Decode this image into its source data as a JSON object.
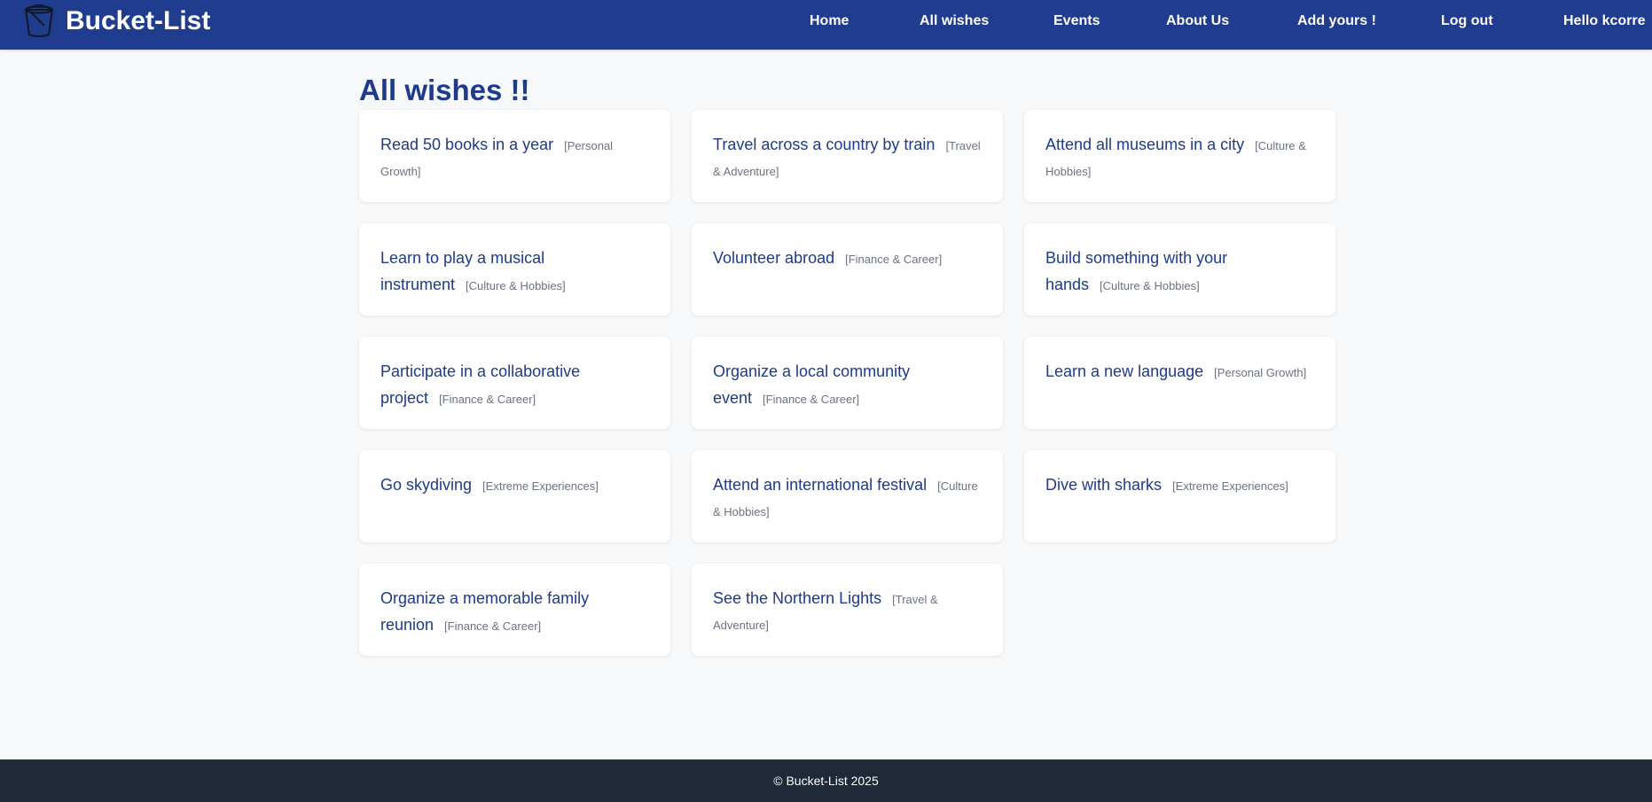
{
  "header": {
    "brand": "Bucket-List",
    "logo_icon": "bucket-icon",
    "bg_color": "#203c8f",
    "nav": [
      {
        "label": "Home"
      },
      {
        "label": "All wishes"
      },
      {
        "label": "Events"
      },
      {
        "label": "About Us"
      },
      {
        "label": "Add yours !"
      },
      {
        "label": "Log out"
      },
      {
        "label": "Hello kcorre"
      }
    ]
  },
  "main": {
    "title": "All wishes !!",
    "wishes": [
      {
        "title": "Read 50 books in a year",
        "category": "[Personal Growth]"
      },
      {
        "title": "Travel across a country by train",
        "category": "[Travel & Adventure]"
      },
      {
        "title": "Attend all museums in a city",
        "category": "[Culture & Hobbies]"
      },
      {
        "title": "Learn to play a musical instrument",
        "category": "[Culture & Hobbies]"
      },
      {
        "title": "Volunteer abroad",
        "category": "[Finance & Career]"
      },
      {
        "title": "Build something with your hands",
        "category": "[Culture & Hobbies]"
      },
      {
        "title": "Participate in a collaborative project",
        "category": "[Finance & Career]"
      },
      {
        "title": "Organize a local community event",
        "category": "[Finance & Career]"
      },
      {
        "title": "Learn a new language",
        "category": "[Personal Growth]"
      },
      {
        "title": "Go skydiving",
        "category": "[Extreme Experiences]"
      },
      {
        "title": "Attend an international festival",
        "category": "[Culture & Hobbies]"
      },
      {
        "title": "Dive with sharks",
        "category": "[Extreme Experiences]"
      },
      {
        "title": "Organize a memorable family reunion",
        "category": "[Finance & Career]"
      },
      {
        "title": "See the Northern Lights",
        "category": "[Travel & Adventure]"
      }
    ]
  },
  "footer": {
    "text": "© Bucket-List 2025",
    "bg_color": "#1f2937"
  }
}
